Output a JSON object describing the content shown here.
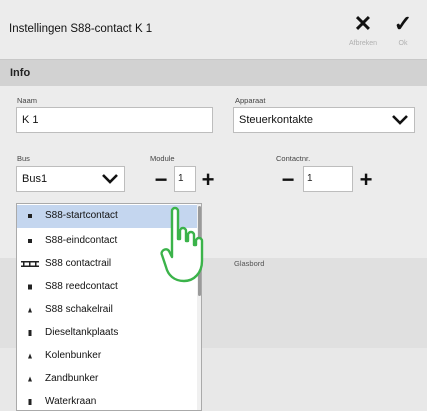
{
  "window": {
    "title": "Instellingen S88-contact K 1",
    "cancel_label": "Afbreken",
    "ok_label": "Ok"
  },
  "section": {
    "title": "Info"
  },
  "fields": {
    "naam_label": "Naam",
    "naam_value": "K 1",
    "apparaat_label": "Apparaat",
    "apparaat_value": "Steuerkontakte",
    "bus_label": "Bus",
    "bus_value": "Bus1",
    "module_label": "Module",
    "module_value": "1",
    "contactnr_label": "Contactnr.",
    "contactnr_value": "1",
    "glasbord_label": "Glasbord"
  },
  "dropdown": {
    "items": [
      {
        "label": "S88-startcontact",
        "icon": "contact-icon",
        "selected": true
      },
      {
        "label": "S88-eindcontact",
        "icon": "contact-icon",
        "selected": false
      },
      {
        "label": "S88 contactrail",
        "icon": "rail-icon",
        "selected": false
      },
      {
        "label": "S88 reedcontact",
        "icon": "reed-icon",
        "selected": false
      },
      {
        "label": "S88 schakelrail",
        "icon": "switch-rail-icon",
        "selected": false
      },
      {
        "label": "Dieseltankplaats",
        "icon": "diesel-icon",
        "selected": false
      },
      {
        "label": "Kolenbunker",
        "icon": "coal-icon",
        "selected": false
      },
      {
        "label": "Zandbunker",
        "icon": "sand-icon",
        "selected": false
      },
      {
        "label": "Waterkraan",
        "icon": "water-icon",
        "selected": false
      }
    ]
  },
  "colors": {
    "selected_item": "#c4d6ef",
    "hand_outline": "#3bb34a"
  }
}
